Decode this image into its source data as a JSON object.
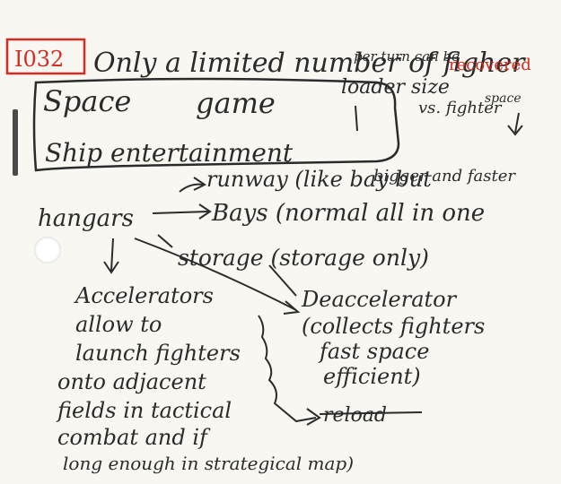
{
  "card_id": "I032",
  "title_line": "Only a limited number of figher",
  "per_turn": "per turn can be",
  "recovered": "recovered",
  "loader_size": "loader size",
  "vs_fighter": "vs. fighter",
  "space": "space",
  "box_line1_a": "Space",
  "box_line1_b": "game",
  "box_line2": "Ship entertainment",
  "runway": "runway (like bay but",
  "bigger": "bigger and faster",
  "hangars": "hangars",
  "bays": "Bays (normal all in one",
  "storage": "storage (storage only)",
  "accelerator_lines": [
    "Accelerators",
    "allow to",
    "launch fighters",
    "onto adjacent",
    "fields in tactical",
    "combat and if",
    "long enough in strategical map)"
  ],
  "deaccelerator_lines": [
    "Deaccelerator",
    "(collects fighters",
    "fast space",
    "efficient)"
  ],
  "reload": "reload"
}
